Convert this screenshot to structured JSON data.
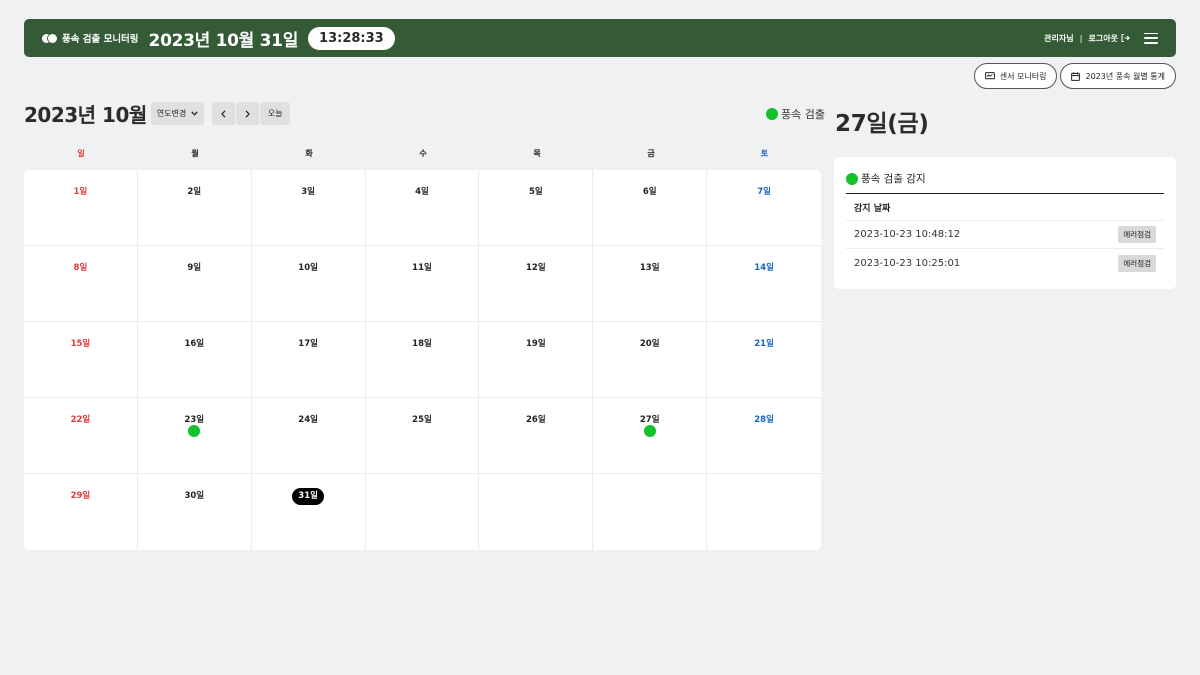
{
  "header": {
    "brand": "풍속 검출 모니터링",
    "date": "2023년 10월 31일",
    "time": "13:28:33",
    "user": "관리자님",
    "separator": "|",
    "logout": "로그아웃"
  },
  "actions": {
    "sensor_monitoring": "센서 모니터링",
    "monthly_stats": "2023년 풍속 월별 통계"
  },
  "calendar": {
    "month_title": "2023년 10월",
    "year_change": "연도변경",
    "today_label": "오늘",
    "legend_label": "풍속 검출",
    "weekdays": [
      "일",
      "월",
      "화",
      "수",
      "목",
      "금",
      "토"
    ],
    "cells": [
      {
        "label": "1일",
        "type": "sun",
        "dot": false
      },
      {
        "label": "2일",
        "type": "",
        "dot": false
      },
      {
        "label": "3일",
        "type": "",
        "dot": false
      },
      {
        "label": "4일",
        "type": "",
        "dot": false
      },
      {
        "label": "5일",
        "type": "",
        "dot": false
      },
      {
        "label": "6일",
        "type": "",
        "dot": false
      },
      {
        "label": "7일",
        "type": "sat",
        "dot": false
      },
      {
        "label": "8일",
        "type": "sun",
        "dot": false
      },
      {
        "label": "9일",
        "type": "",
        "dot": false
      },
      {
        "label": "10일",
        "type": "",
        "dot": false
      },
      {
        "label": "11일",
        "type": "",
        "dot": false
      },
      {
        "label": "12일",
        "type": "",
        "dot": false
      },
      {
        "label": "13일",
        "type": "",
        "dot": false
      },
      {
        "label": "14일",
        "type": "sat",
        "dot": false
      },
      {
        "label": "15일",
        "type": "sun",
        "dot": false
      },
      {
        "label": "16일",
        "type": "",
        "dot": false
      },
      {
        "label": "17일",
        "type": "",
        "dot": false
      },
      {
        "label": "18일",
        "type": "",
        "dot": false
      },
      {
        "label": "19일",
        "type": "",
        "dot": false
      },
      {
        "label": "20일",
        "type": "",
        "dot": false
      },
      {
        "label": "21일",
        "type": "sat",
        "dot": false
      },
      {
        "label": "22일",
        "type": "sun",
        "dot": false
      },
      {
        "label": "23일",
        "type": "",
        "dot": true
      },
      {
        "label": "24일",
        "type": "",
        "dot": false
      },
      {
        "label": "25일",
        "type": "",
        "dot": false
      },
      {
        "label": "26일",
        "type": "",
        "dot": false
      },
      {
        "label": "27일",
        "type": "",
        "dot": true
      },
      {
        "label": "28일",
        "type": "sat",
        "dot": false
      },
      {
        "label": "29일",
        "type": "sun",
        "dot": false
      },
      {
        "label": "30일",
        "type": "",
        "dot": false
      },
      {
        "label": "31일",
        "type": "today",
        "dot": false
      },
      {
        "label": "",
        "type": "",
        "dot": false
      },
      {
        "label": "",
        "type": "",
        "dot": false
      },
      {
        "label": "",
        "type": "",
        "dot": false
      },
      {
        "label": "",
        "type": "",
        "dot": false
      }
    ]
  },
  "detail": {
    "title": "27일(금)",
    "panel_title": "풍속 검출 감지",
    "column_header": "감지 날짜",
    "rows": [
      {
        "datetime": "2023-10-23 10:48:12",
        "action": "에러점검"
      },
      {
        "datetime": "2023-10-23 10:25:01",
        "action": "에러점검"
      }
    ]
  },
  "colors": {
    "header_bg": "#355a36",
    "detect_dot": "#12c12b",
    "sunday": "#e53935",
    "saturday": "#1565c0"
  },
  "icons": [
    "brand-logo-icon",
    "logout-icon",
    "menu-icon",
    "monitor-icon",
    "calendar-icon",
    "chevron-down-icon",
    "chevron-left-icon",
    "chevron-right-icon"
  ]
}
